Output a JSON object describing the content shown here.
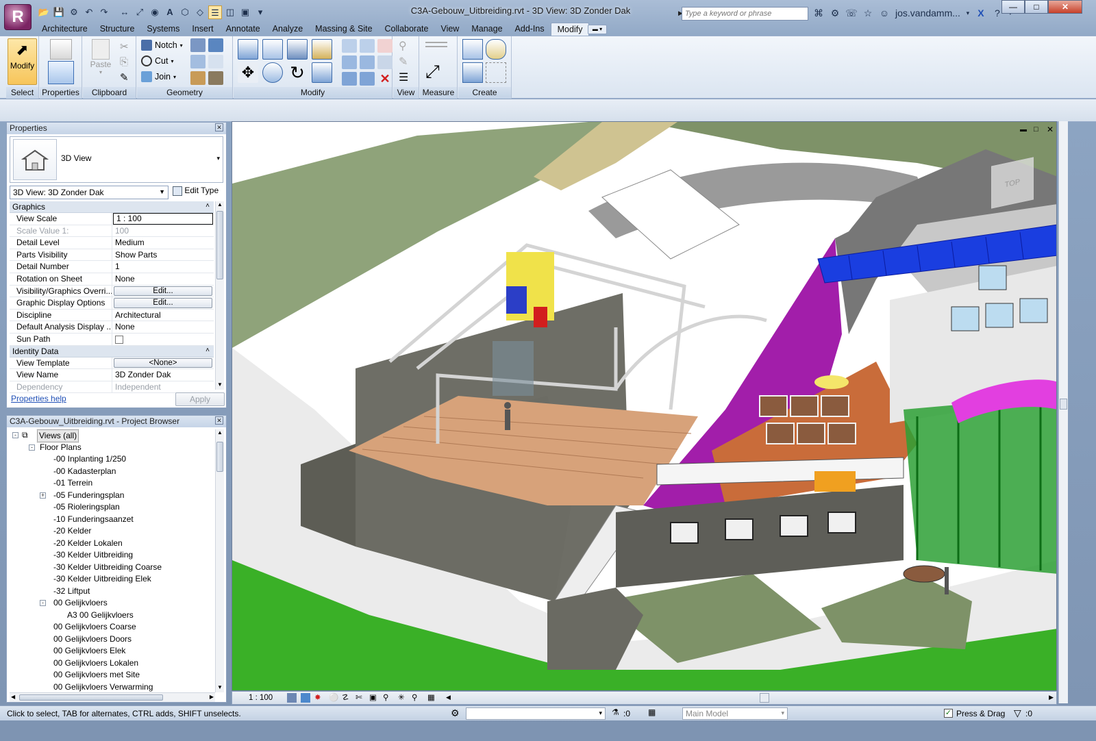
{
  "app": {
    "title": "C3A-Gebouw_Uitbreiding.rvt - 3D View: 3D Zonder Dak",
    "logo_letter": "R",
    "search_placeholder": "Type a keyword or phrase",
    "user": "jos.vandamm...",
    "accent": "#f7c55a"
  },
  "tabs": [
    "Architecture",
    "Structure",
    "Systems",
    "Insert",
    "Annotate",
    "Analyze",
    "Massing & Site",
    "Collaborate",
    "View",
    "Manage",
    "Add-Ins",
    "Modify"
  ],
  "active_tab": "Modify",
  "ribbon": {
    "select": {
      "button": "Modify",
      "panel": "Select"
    },
    "properties": {
      "panel": "Properties"
    },
    "clipboard": {
      "paste": "Paste",
      "panel": "Clipboard"
    },
    "geometry": {
      "notch": "Notch",
      "cut": "Cut",
      "join": "Join",
      "panel": "Geometry"
    },
    "modify": {
      "panel": "Modify"
    },
    "view": {
      "panel": "View"
    },
    "measure": {
      "panel": "Measure"
    },
    "create": {
      "panel": "Create"
    }
  },
  "properties": {
    "header": "Properties",
    "type_name": "3D View",
    "view_selector": "3D View: 3D Zonder Dak",
    "edit_type": "Edit Type",
    "groups": [
      {
        "name": "Graphics",
        "rows": [
          {
            "key": "View Scale",
            "value": "1 : 100",
            "style": "box"
          },
          {
            "key": "Scale Value    1:",
            "value": "100",
            "style": "dis"
          },
          {
            "key": "Detail Level",
            "value": "Medium"
          },
          {
            "key": "Parts Visibility",
            "value": "Show Parts"
          },
          {
            "key": "Detail Number",
            "value": "1"
          },
          {
            "key": "Rotation on Sheet",
            "value": "None"
          },
          {
            "key": "Visibility/Graphics Overri...",
            "value": "Edit...",
            "style": "btn"
          },
          {
            "key": "Graphic Display Options",
            "value": "Edit...",
            "style": "btn"
          },
          {
            "key": "Discipline",
            "value": "Architectural"
          },
          {
            "key": "Default Analysis Display ...",
            "value": "None"
          },
          {
            "key": "Sun Path",
            "value": "",
            "style": "check"
          }
        ]
      },
      {
        "name": "Identity Data",
        "rows": [
          {
            "key": "View Template",
            "value": "<None>",
            "style": "btn"
          },
          {
            "key": "View Name",
            "value": "3D Zonder Dak"
          },
          {
            "key": "Dependency",
            "value": "Independent",
            "style": "dis"
          }
        ]
      }
    ],
    "help_link": "Properties help",
    "apply": "Apply"
  },
  "browser": {
    "header": "C3A-Gebouw_Uitbreiding.rvt - Project Browser",
    "items": [
      {
        "label": "Views (all)",
        "level": 0,
        "toggle": "-"
      },
      {
        "label": "Floor Plans",
        "level": 1,
        "toggle": "-"
      },
      {
        "label": "-00 Inplanting 1/250",
        "level": 2
      },
      {
        "label": "-00 Kadasterplan",
        "level": 2
      },
      {
        "label": "-01 Terrein",
        "level": 2
      },
      {
        "label": "-05 Funderingsplan",
        "level": 2,
        "toggle": "+"
      },
      {
        "label": "-05 Rioleringsplan",
        "level": 2
      },
      {
        "label": "-10 Funderingsaanzet",
        "level": 2
      },
      {
        "label": "-20 Kelder",
        "level": 2
      },
      {
        "label": "-20 Kelder Lokalen",
        "level": 2
      },
      {
        "label": "-30 Kelder Uitbreiding",
        "level": 2
      },
      {
        "label": "-30 Kelder Uitbreiding Coarse",
        "level": 2
      },
      {
        "label": "-30 Kelder Uitbreiding Elek",
        "level": 2
      },
      {
        "label": "-32 Liftput",
        "level": 2
      },
      {
        "label": "00 Gelijkvloers",
        "level": 2,
        "toggle": "-"
      },
      {
        "label": "A3 00 Gelijkvloers",
        "level": 3
      },
      {
        "label": "00 Gelijkvloers Coarse",
        "level": 2
      },
      {
        "label": "00 Gelijkvloers Doors",
        "level": 2
      },
      {
        "label": "00 Gelijkvloers Elek",
        "level": 2
      },
      {
        "label": "00 Gelijkvloers Lokalen",
        "level": 2
      },
      {
        "label": "00 Gelijkvloers met Site",
        "level": 2
      },
      {
        "label": "00 Gelijkvloers Verwarming",
        "level": 2
      }
    ]
  },
  "viewcube": {
    "label": "TOP"
  },
  "viewbar": {
    "scale": "1 : 100"
  },
  "status": {
    "hint": "Click to select, TAB for alternates, CTRL adds, SHIFT unselects.",
    "filter_count": ":0",
    "model": "Main Model",
    "press_drag": "Press & Drag",
    "sel_count": ":0"
  }
}
